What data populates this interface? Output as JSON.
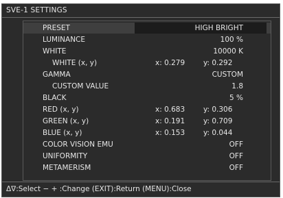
{
  "title": "SVE-1 SETTINGS",
  "rows": [
    {
      "label": "PRESET",
      "value": "HIGH BRIGHT"
    },
    {
      "label": "LUMINANCE",
      "value": "100 %"
    },
    {
      "label": "WHITE",
      "value": "10000  K"
    },
    {
      "label": "WHITE (x, y)",
      "x": "x: 0.279",
      "y": "y: 0.292"
    },
    {
      "label": "GAMMA",
      "value": "CUSTOM"
    },
    {
      "label": "CUSTOM VALUE",
      "value": "1.8"
    },
    {
      "label": "BLACK",
      "value": "5 %"
    },
    {
      "label": "RED (x, y)",
      "x": "x: 0.683",
      "y": "y: 0.306"
    },
    {
      "label": "GREEN (x, y)",
      "x": "x: 0.191",
      "y": "y: 0.709"
    },
    {
      "label": "BLUE (x, y)",
      "x": "x: 0.153",
      "y": "y: 0.044"
    },
    {
      "label": "COLOR VISION EMU",
      "value": "OFF"
    },
    {
      "label": "UNIFORMITY",
      "value": "OFF"
    },
    {
      "label": "METAMERISM",
      "value": "OFF"
    }
  ],
  "footer": "Δ∇:Select  − + :Change (EXIT):Return (MENU):Close"
}
